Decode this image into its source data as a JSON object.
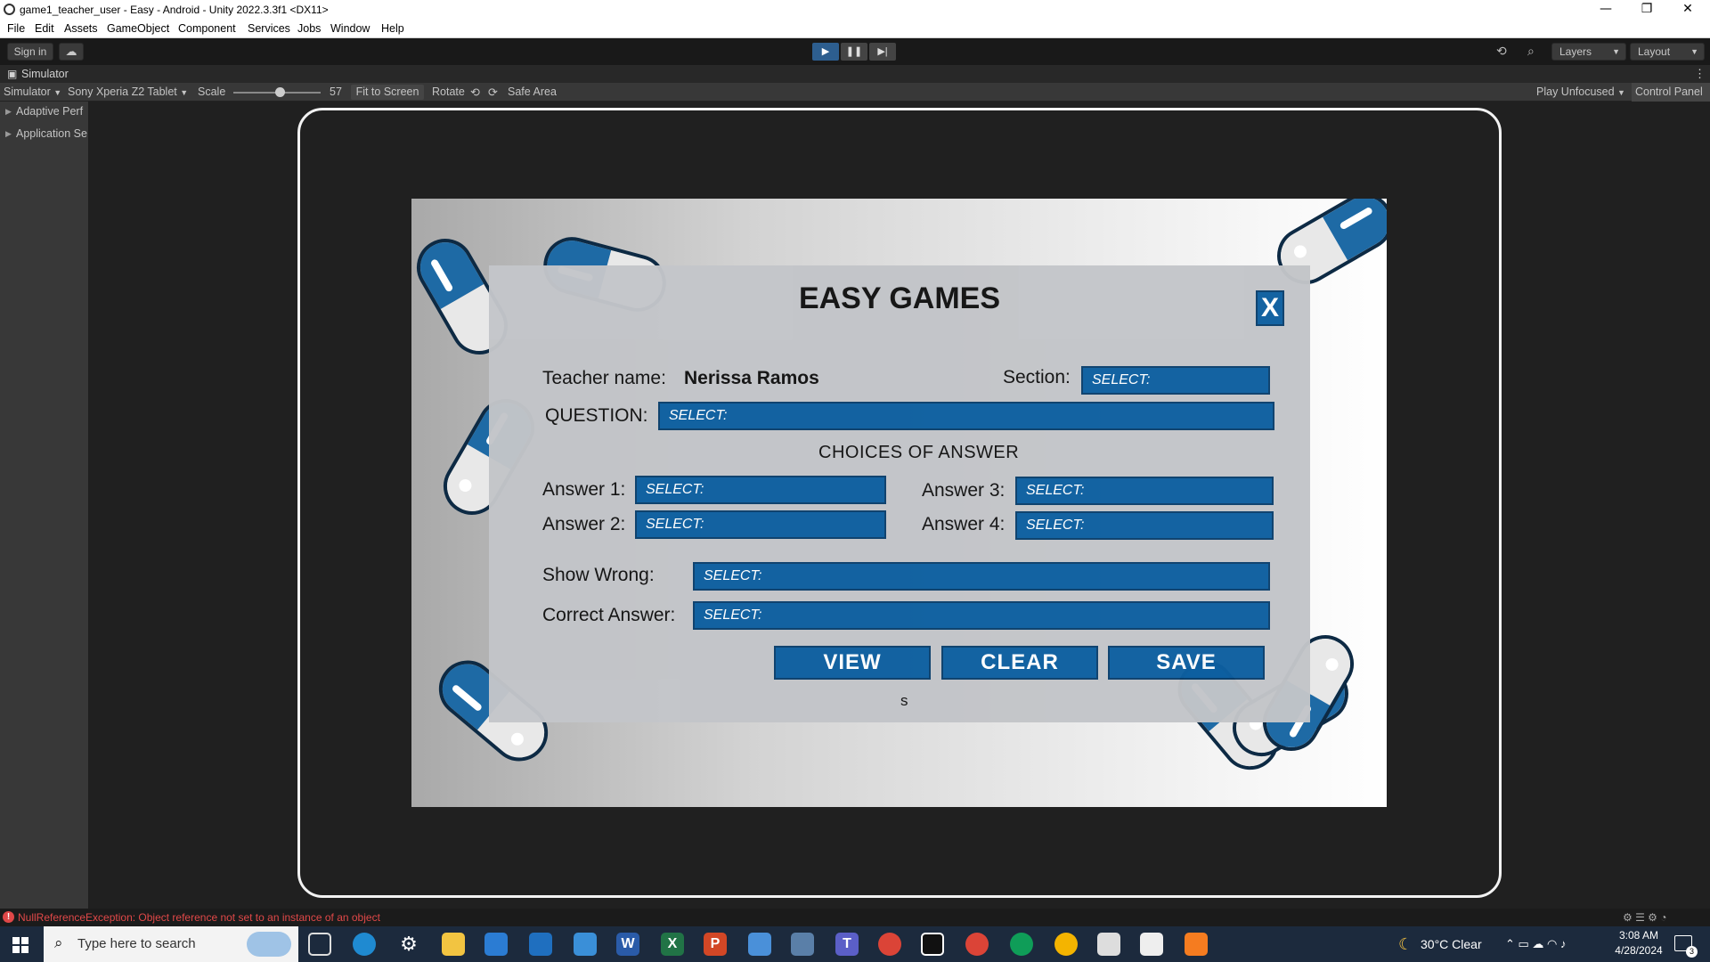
{
  "window": {
    "title": "game1_teacher_user - Easy - Android - Unity 2022.3.3f1 <DX11>",
    "minimize": "—",
    "maximize": "❐",
    "close": "✕"
  },
  "menu": [
    "File",
    "Edit",
    "Assets",
    "GameObject",
    "Component",
    "Services",
    "Jobs",
    "Window",
    "Help"
  ],
  "toolbar": {
    "sign_in": "Sign in",
    "layers": "Layers",
    "layout": "Layout"
  },
  "simulator": {
    "tab_label": "Simulator",
    "mode": "Simulator",
    "device": "Sony Xperia Z2 Tablet",
    "scale_label": "Scale",
    "scale_value": "57",
    "fit_to_screen": "Fit to Screen",
    "rotate": "Rotate",
    "safe_area": "Safe Area",
    "play_unfocused": "Play Unfocused",
    "control_panel": "Control Panel"
  },
  "left_panel": [
    "Adaptive Perf",
    "Application Se"
  ],
  "game": {
    "title": "EASY GAMES",
    "close": "X",
    "teacher_label": "Teacher name:",
    "teacher_name": "Nerissa Ramos",
    "section_label": "Section:",
    "section_value": "SELECT:",
    "question_label": "QUESTION:",
    "question_value": "SELECT:",
    "choices_heading": "CHOICES OF ANSWER",
    "answer1_label": "Answer 1:",
    "answer1_value": "SELECT:",
    "answer2_label": "Answer 2:",
    "answer2_value": "SELECT:",
    "answer3_label": "Answer 3:",
    "answer3_value": "SELECT:",
    "answer4_label": "Answer 4:",
    "answer4_value": "SELECT:",
    "show_wrong_label": "Show Wrong:",
    "show_wrong_value": "SELECT:",
    "correct_label": "Correct Answer:",
    "correct_value": "SELECT:",
    "view": "VIEW",
    "clear": "CLEAR",
    "save": "SAVE",
    "footer_char": "s"
  },
  "console_error": "NullReferenceException: Object reference not set to an instance of an object",
  "taskbar": {
    "search_placeholder": "Type here to search",
    "weather": "30°C  Clear",
    "time": "3:08 AM",
    "date": "4/28/2024",
    "notif_count": "3"
  },
  "colors": {
    "field_blue": "#0d5fa0",
    "panel_grey": "#c3c5c9",
    "pill_blue": "#1e6aa5",
    "error_red": "#e04848"
  }
}
